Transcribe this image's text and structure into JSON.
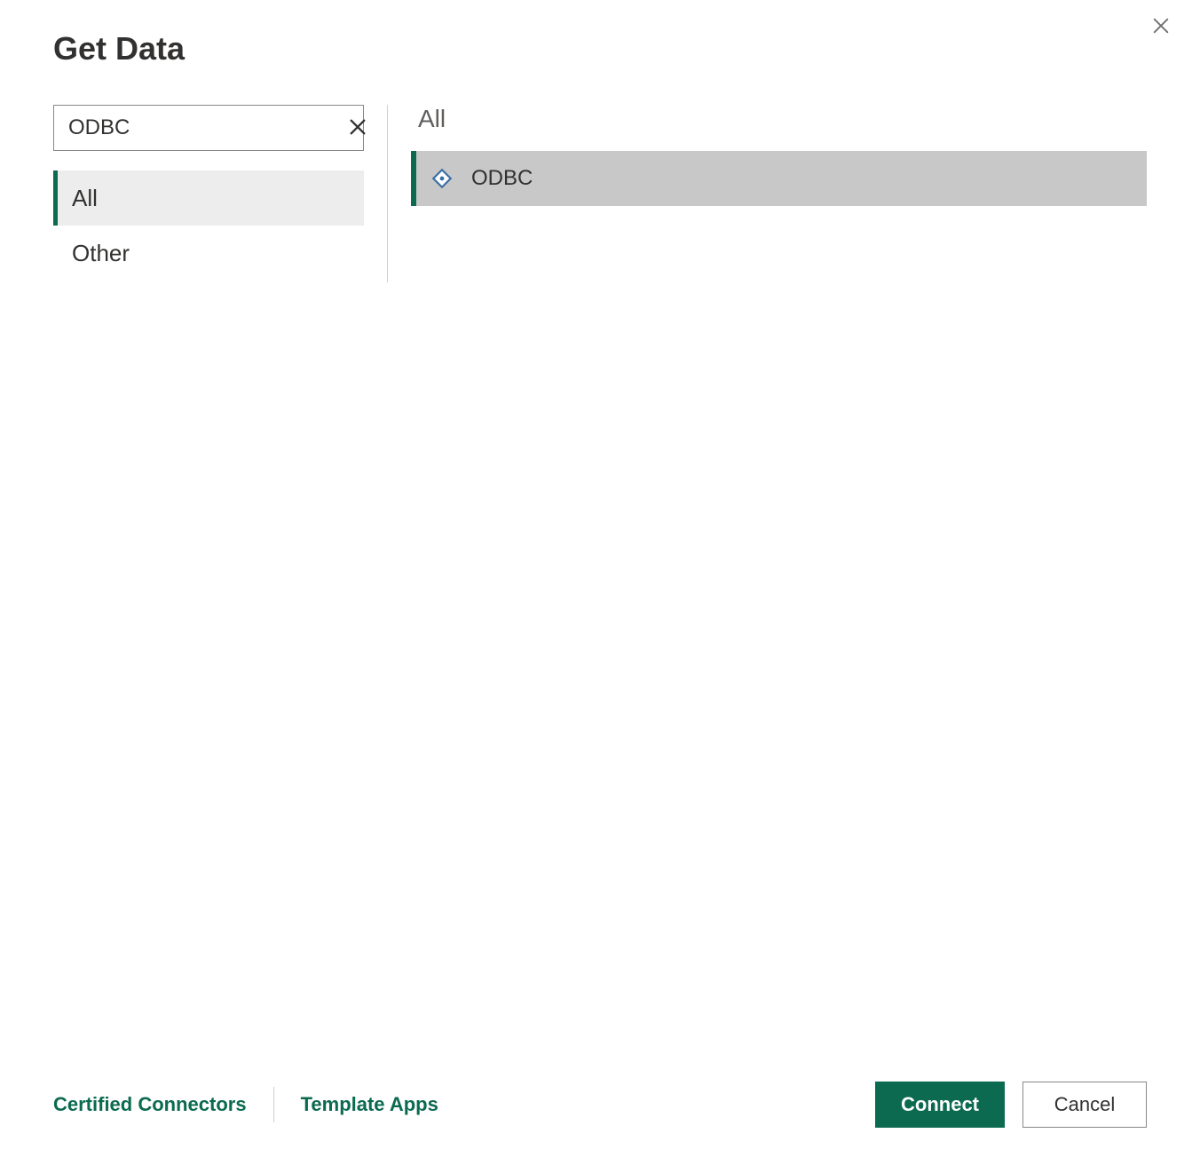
{
  "dialog": {
    "title": "Get Data"
  },
  "search": {
    "value": "ODBC"
  },
  "sidebar": {
    "categories": [
      {
        "label": "All",
        "selected": true
      },
      {
        "label": "Other",
        "selected": false
      }
    ]
  },
  "results": {
    "heading": "All",
    "items": [
      {
        "label": "ODBC",
        "icon": "odbc-connector-icon"
      }
    ]
  },
  "footer": {
    "certified_label": "Certified Connectors",
    "template_label": "Template Apps",
    "connect_label": "Connect",
    "cancel_label": "Cancel"
  }
}
